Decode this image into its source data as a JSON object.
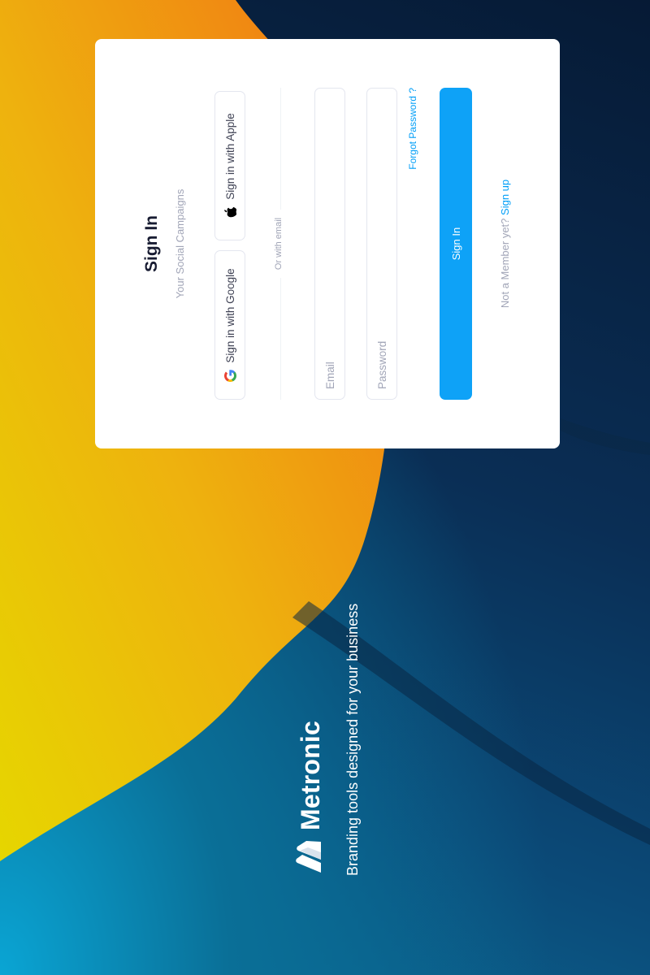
{
  "brand": {
    "name": "Metronic",
    "tagline": "Branding tools designed for your business"
  },
  "signin_card": {
    "title": "Sign In",
    "subtitle": "Your Social Campaigns",
    "google_label": "Sign in with Google",
    "apple_label": "Sign in with Apple",
    "divider_text": "Or with email",
    "email_placeholder": "Email",
    "password_placeholder": "Password",
    "forgot_label": "Forgot Password ?",
    "submit_label": "Sign In",
    "member_prompt": "Not a Member yet?",
    "signup_label": "Sign up"
  },
  "colors": {
    "accent": "#009ef7",
    "button": "#0ea2f7",
    "title_text": "#181c32",
    "muted_text": "#a1a5b7",
    "bg_orange": "#f29a1a",
    "bg_yellow": "#e6d600",
    "bg_navy": "#061a35"
  },
  "icons": [
    "google-icon",
    "apple-icon",
    "metronic-logo-icon"
  ]
}
